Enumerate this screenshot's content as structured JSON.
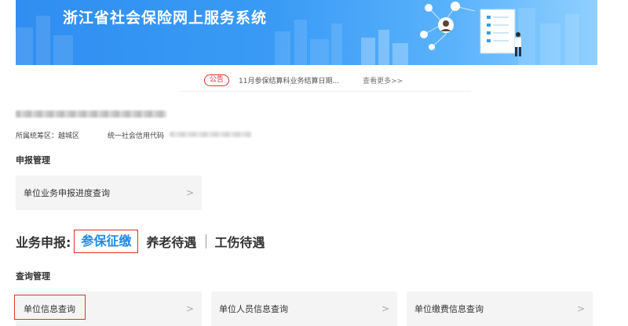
{
  "banner": {
    "title": "浙江省社会保险网上服务系统"
  },
  "notice": {
    "badge": "公告",
    "text": "11月参保结算科业务结算日期...",
    "more": "查看更多>>"
  },
  "org": {
    "district_label": "所属统筹区：越城区",
    "credit_label": "统一社会信用代码"
  },
  "declare_section": {
    "title": "申报管理",
    "cards": [
      {
        "label": "单位业务申报进度查询",
        "chevron": ">"
      }
    ]
  },
  "business": {
    "label": "业务申报:",
    "tabs": [
      {
        "label": "参保征缴",
        "active": true
      },
      {
        "label": "养老待遇",
        "active": false
      },
      {
        "label": "工伤待遇",
        "active": false
      }
    ]
  },
  "query_section": {
    "title": "查询管理",
    "cards": [
      {
        "label": "单位信息查询",
        "chevron": ">"
      },
      {
        "label": "单位人员信息查询",
        "chevron": ">"
      },
      {
        "label": "单位缴费信息查询",
        "chevron": ">"
      }
    ]
  },
  "colors": {
    "accent": "#1e88e5",
    "alert": "#e0322c",
    "banner": "#3a9bf6",
    "card_bg": "#f4f4f4"
  }
}
